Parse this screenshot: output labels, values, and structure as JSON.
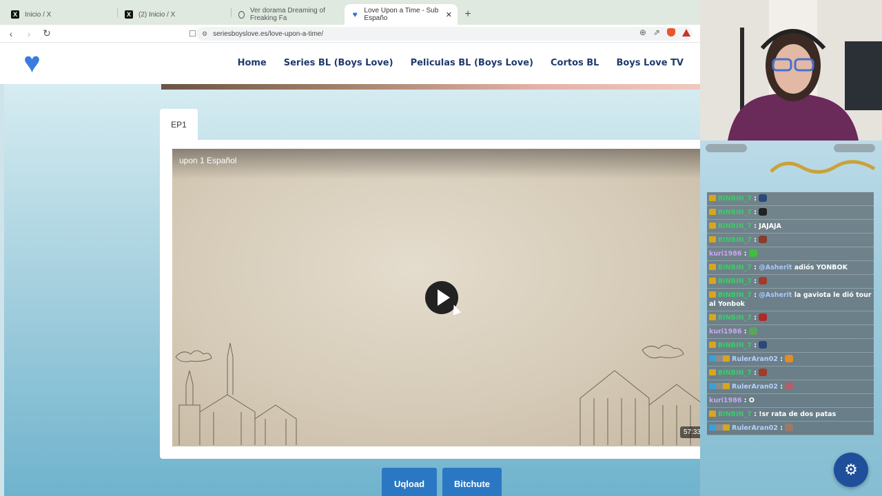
{
  "browser": {
    "tabs": [
      {
        "title": "Inicio / X",
        "icon": "x-logo-icon"
      },
      {
        "title": "(2) Inicio / X",
        "icon": "x-logo-icon"
      },
      {
        "title": "Ver dorama Dreaming of Freaking Fa",
        "icon": "globe-icon"
      },
      {
        "title": "Love Upon a Time - Sub Españo",
        "icon": "heart-icon",
        "active": true
      }
    ],
    "url": "seriesboyslove.es/love-upon-a-time/"
  },
  "site": {
    "nav": [
      "Home",
      "Series BL (Boys Love)",
      "Peliculas BL (Boys Love)",
      "Cortos BL",
      "Boys Love TV"
    ]
  },
  "player": {
    "tab_label": "EP1",
    "video_title": "upon 1 Español",
    "duration": "57:33"
  },
  "servers": [
    "Uqload",
    "Bitchute"
  ],
  "chat": {
    "messages": [
      {
        "badges": "crown",
        "user": "BINBIN_7",
        "user_color": "green",
        "text": "",
        "emote": "#2b4a7a"
      },
      {
        "badges": "crown",
        "user": "BINBIN_7",
        "user_color": "green",
        "text": "",
        "emote": "#222222"
      },
      {
        "badges": "crown",
        "user": "BINBIN_7",
        "user_color": "green",
        "text": "JAJAJA",
        "emote": ""
      },
      {
        "badges": "crown",
        "user": "BINBIN_7",
        "user_color": "green",
        "text": "",
        "emote": "#8a3b2c"
      },
      {
        "badges": "",
        "user": "kuri1986",
        "user_color": "purple",
        "text": "",
        "emote": "#3fbf3f"
      },
      {
        "badges": "crown",
        "user": "BINBIN_7",
        "user_color": "green",
        "mention": "@Asherit",
        "text": "adiós YONBOK",
        "emote": ""
      },
      {
        "badges": "crown",
        "user": "BINBIN_7",
        "user_color": "green",
        "text": "",
        "emote": "#a33b2a"
      },
      {
        "badges": "crown",
        "user": "BINBIN_7",
        "user_color": "green",
        "mention": "@Asherit",
        "text": "la gaviota le dió tour al Yonbok",
        "emote": ""
      },
      {
        "badges": "crown",
        "user": "BINBIN_7",
        "user_color": "green",
        "text": "",
        "emote": "#b02a2a"
      },
      {
        "badges": "",
        "user": "kuri1986",
        "user_color": "purple",
        "text": "",
        "emote": "#5aa65a"
      },
      {
        "badges": "crown",
        "user": "BINBIN_7",
        "user_color": "green",
        "text": "",
        "emote": "#2b4a7a"
      },
      {
        "badges": "multi",
        "user": "RulerAran02",
        "user_color": "blue",
        "text": "",
        "emote": "#e38a2a"
      },
      {
        "badges": "crown",
        "user": "BINBIN_7",
        "user_color": "green",
        "text": "",
        "emote": "#a33b2a"
      },
      {
        "badges": "multi",
        "user": "RulerAran02",
        "user_color": "blue",
        "text": "",
        "emote": "#b0606a"
      },
      {
        "badges": "",
        "user": "kuri1986",
        "user_color": "purple",
        "text": "O",
        "emote": ""
      },
      {
        "badges": "crown",
        "user": "BINBIN_7",
        "user_color": "green",
        "text": "!sr rata de dos patas",
        "emote": ""
      },
      {
        "badges": "multi",
        "user": "RulerAran02",
        "user_color": "blue",
        "text": "",
        "emote": "#9a7a6a"
      }
    ]
  }
}
